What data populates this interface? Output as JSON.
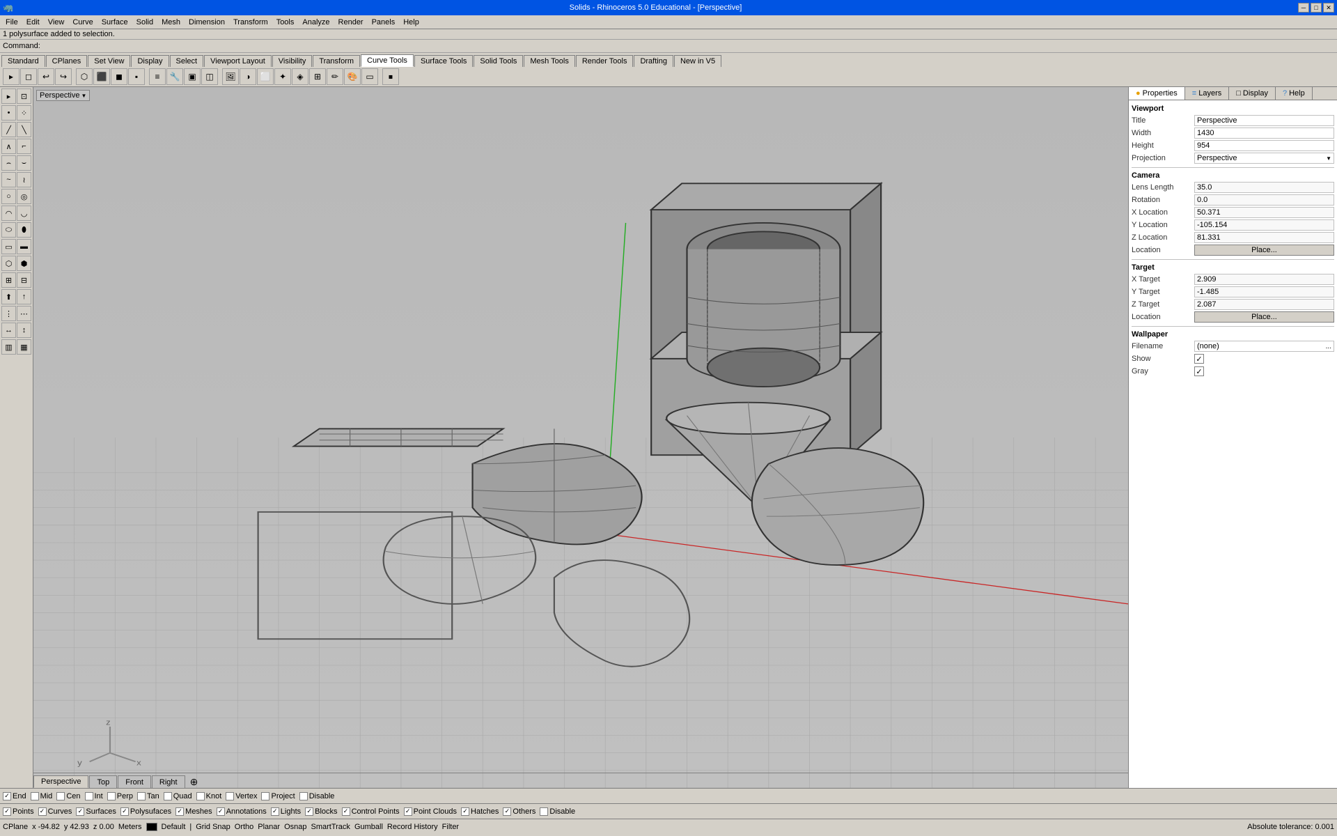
{
  "titleBar": {
    "title": "Solids - Rhinoceros 5.0 Educational - [Perspective]",
    "minimize": "─",
    "maximize": "□",
    "close": "✕"
  },
  "menuBar": {
    "items": [
      "File",
      "Edit",
      "View",
      "Curve",
      "Surface",
      "Solid",
      "Mesh",
      "Dimension",
      "Transform",
      "Tools",
      "Analyze",
      "Render",
      "Panels",
      "Help"
    ]
  },
  "statusTop": "1 polysurface added to selection.",
  "commandLabel": "Command:",
  "commandValue": "",
  "toolbarTabs": {
    "tabs": [
      "Standard",
      "CPlanes",
      "Set View",
      "Display",
      "Select",
      "Viewport Layout",
      "Visibility",
      "Transform",
      "Curve Tools",
      "Surface Tools",
      "Solid Tools",
      "Mesh Tools",
      "Render Tools",
      "Drafting",
      "New in V5"
    ],
    "active": "Curve Tools"
  },
  "viewport": {
    "label": "Perspective",
    "tabs": [
      "Perspective",
      "Top",
      "Front",
      "Right"
    ],
    "active": "Perspective"
  },
  "rightPanel": {
    "tabs": [
      "Properties",
      "Layers",
      "Display",
      "Help"
    ],
    "active": "Properties",
    "sections": {
      "viewport": {
        "title": "Viewport",
        "title_field": "Title",
        "title_value": "Perspective",
        "width_label": "Width",
        "width_value": "1430",
        "height_label": "Height",
        "height_value": "954",
        "projection_label": "Projection",
        "projection_value": "Perspective"
      },
      "camera": {
        "title": "Camera",
        "lensLength_label": "Lens Length",
        "lensLength_value": "35.0",
        "rotation_label": "Rotation",
        "rotation_value": "0.0",
        "xLocation_label": "X Location",
        "xLocation_value": "50.371",
        "yLocation_label": "Y Location",
        "yLocation_value": "-105.154",
        "zLocation_label": "Z Location",
        "zLocation_value": "81.331",
        "location_label": "Location",
        "location_btn": "Place..."
      },
      "target": {
        "title": "Target",
        "xTarget_label": "X Target",
        "xTarget_value": "2.909",
        "yTarget_label": "Y Target",
        "yTarget_value": "-1.485",
        "zTarget_label": "Z Target",
        "zTarget_value": "2.087",
        "location_label": "Location",
        "location_btn": "Place..."
      },
      "wallpaper": {
        "title": "Wallpaper",
        "filename_label": "Filename",
        "filename_value": "(none)",
        "show_label": "Show",
        "gray_label": "Gray"
      }
    }
  },
  "osnapBar": {
    "items": [
      {
        "label": "End",
        "checked": true
      },
      {
        "label": "Mid",
        "checked": false
      },
      {
        "label": "Cen",
        "checked": false
      },
      {
        "label": "Int",
        "checked": false
      },
      {
        "label": "Perp",
        "checked": false
      },
      {
        "label": "Tan",
        "checked": false
      },
      {
        "label": "Quad",
        "checked": false
      },
      {
        "label": "Knot",
        "checked": false
      },
      {
        "label": "Vertex",
        "checked": false
      },
      {
        "label": "Project",
        "checked": false
      },
      {
        "label": "Disable",
        "checked": false
      }
    ]
  },
  "snapBar": {
    "items": [
      {
        "label": "Points",
        "checked": true
      },
      {
        "label": "Curves",
        "checked": true
      },
      {
        "label": "Surfaces",
        "checked": true
      },
      {
        "label": "Polysufaces",
        "checked": true
      },
      {
        "label": "Meshes",
        "checked": true
      },
      {
        "label": "Annotations",
        "checked": true
      },
      {
        "label": "Lights",
        "checked": true
      },
      {
        "label": "Blocks",
        "checked": true
      },
      {
        "label": "Control Points",
        "checked": true
      },
      {
        "label": "Point Clouds",
        "checked": true
      },
      {
        "label": "Hatches",
        "checked": true
      },
      {
        "label": "Others",
        "checked": true
      },
      {
        "label": "Disable",
        "checked": false
      }
    ]
  },
  "statusBottom": {
    "cplane": "CPlane",
    "x": "x -94.82",
    "y": "y 42.93",
    "z": "z 0.00",
    "units": "Meters",
    "default": "Default",
    "gridSnap": "Grid Snap",
    "ortho": "Ortho",
    "planar": "Planar",
    "osnap": "Osnap",
    "smarttrack": "SmartTrack",
    "gumball": "Gumball",
    "recordHistory": "Record History",
    "filter": "Filter",
    "tolerance": "Absolute tolerance: 0.001"
  }
}
